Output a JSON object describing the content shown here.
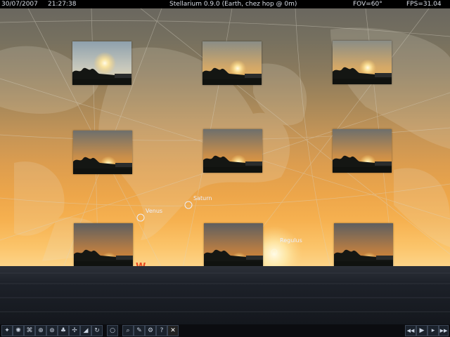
{
  "app": {
    "title": "Stellarium 0.9.0 (Earth, chez hop @ 0m)",
    "date": "30/07/2007",
    "time": "21:27:38",
    "fov": "FOV=60°",
    "fps": "FPS=31.04"
  },
  "sky": {
    "planet_labels": [
      {
        "name": "Saturn"
      },
      {
        "name": "Venus"
      },
      {
        "name": "Regulus"
      }
    ],
    "cardinal": "W"
  },
  "photos": [
    {
      "label": "sunset-photo-1",
      "phase": "high-sun"
    },
    {
      "label": "sunset-photo-2",
      "phase": "mid-sun"
    },
    {
      "label": "sunset-photo-3",
      "phase": "mid-sun"
    },
    {
      "label": "sunset-photo-4",
      "phase": "low-sun"
    },
    {
      "label": "sunset-photo-5",
      "phase": "low-sun"
    },
    {
      "label": "sunset-photo-6",
      "phase": "low-sun"
    },
    {
      "label": "sunset-photo-7",
      "phase": "setting"
    },
    {
      "label": "sunset-photo-8",
      "phase": "setting"
    },
    {
      "label": "sunset-photo-9",
      "phase": "setting"
    }
  ],
  "toolbar": {
    "left_buttons": [
      {
        "name": "constellation-lines-button",
        "icon": "constellation-lines-icon"
      },
      {
        "name": "constellation-art-button",
        "icon": "constellation-art-icon"
      },
      {
        "name": "azimuth-grid-button",
        "icon": "azimuth-grid-icon"
      },
      {
        "name": "equatorial-grid-button",
        "icon": "equatorial-grid-icon"
      },
      {
        "name": "ground-button",
        "icon": "ground-icon"
      },
      {
        "name": "cardinal-points-button",
        "icon": "cardinal-points-icon"
      },
      {
        "name": "atmosphere-button",
        "icon": "atmosphere-icon"
      },
      {
        "name": "nebulas-button",
        "icon": "nebulas-icon"
      },
      {
        "name": "mount-button",
        "icon": "mount-icon"
      },
      {
        "name": "search-button",
        "icon": "search-icon"
      },
      {
        "name": "config-button",
        "icon": "config-icon"
      },
      {
        "name": "scripts-button",
        "icon": "scripts-icon"
      },
      {
        "name": "help-button",
        "icon": "help-icon"
      },
      {
        "name": "quit-button",
        "icon": "close-icon",
        "glyph": "✕"
      }
    ],
    "right_buttons": [
      {
        "name": "rewind-button",
        "icon": "rewind-icon",
        "glyph": "◀◀"
      },
      {
        "name": "play-button",
        "icon": "play-icon",
        "glyph": "▶"
      },
      {
        "name": "realtime-button",
        "icon": "realtime-icon",
        "glyph": "▶"
      },
      {
        "name": "fast-forward-button",
        "icon": "fast-forward-icon",
        "glyph": "▶▶"
      }
    ]
  },
  "colors": {
    "label": "#eaf0ff",
    "cardinal": "#e8491d",
    "grid": "#d9d4c5"
  }
}
